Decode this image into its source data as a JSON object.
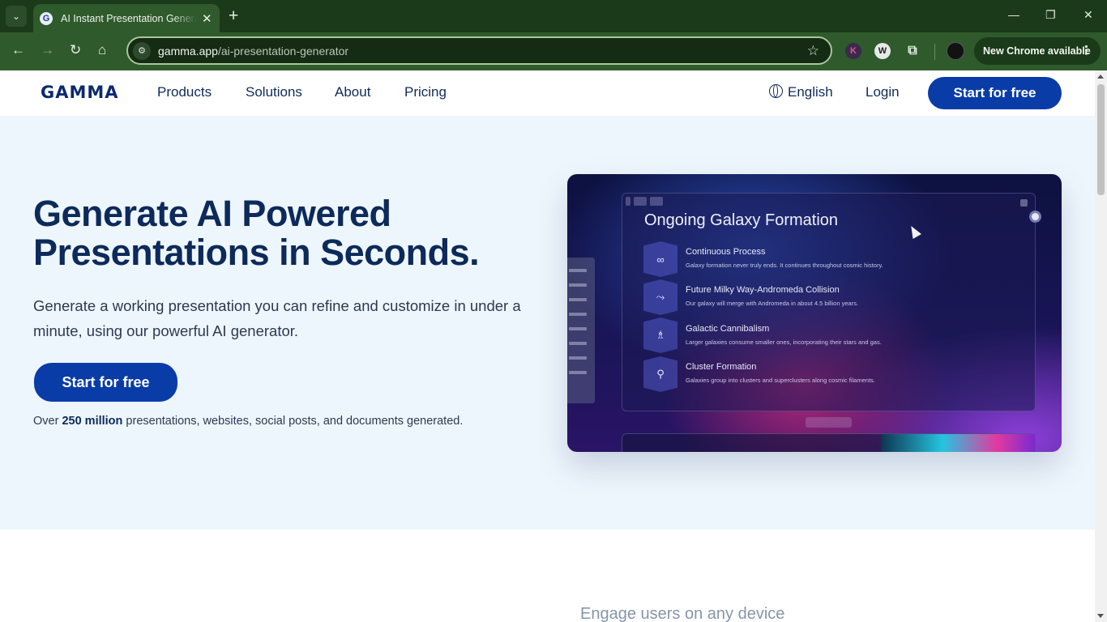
{
  "browser": {
    "tab_title": "AI Instant Presentation Generator",
    "tab_favicon": "G",
    "url_domain": "gamma.app",
    "url_path": "/ai-presentation-generator",
    "new_chrome_label": "New Chrome available",
    "ext_k": "K",
    "ext_w": "W"
  },
  "nav": {
    "logo": "GAMMA",
    "links": [
      "Products",
      "Solutions",
      "About",
      "Pricing"
    ],
    "language": "English",
    "login": "Login",
    "cta": "Start for free"
  },
  "hero": {
    "headline": "Generate AI Powered Presentations in Seconds.",
    "subheadline": "Generate a working presentation you can refine and customize in under a minute, using our powerful AI generator.",
    "cta": "Start for free",
    "stats_prefix": "Over ",
    "stats_bold": "250 million",
    "stats_suffix": " presentations, websites, social posts, and documents generated."
  },
  "preview": {
    "title": "Ongoing Galaxy Formation",
    "rows": [
      {
        "title": "Continuous Process",
        "desc": "Galaxy formation never truly ends. It continues throughout cosmic history.",
        "icon": "∞"
      },
      {
        "title": "Future Milky Way-Andromeda Collision",
        "desc": "Our galaxy will merge with Andromeda in about 4.5 billion years.",
        "icon": "⤳"
      },
      {
        "title": "Galactic Cannibalism",
        "desc": "Larger galaxies consume smaller ones, incorporating their stars and gas.",
        "icon": "♗"
      },
      {
        "title": "Cluster Formation",
        "desc": "Galaxies group into clusters and superclusters along cosmic filaments.",
        "icon": "⚲"
      }
    ]
  },
  "below": {
    "engage": "Engage users on any device"
  }
}
